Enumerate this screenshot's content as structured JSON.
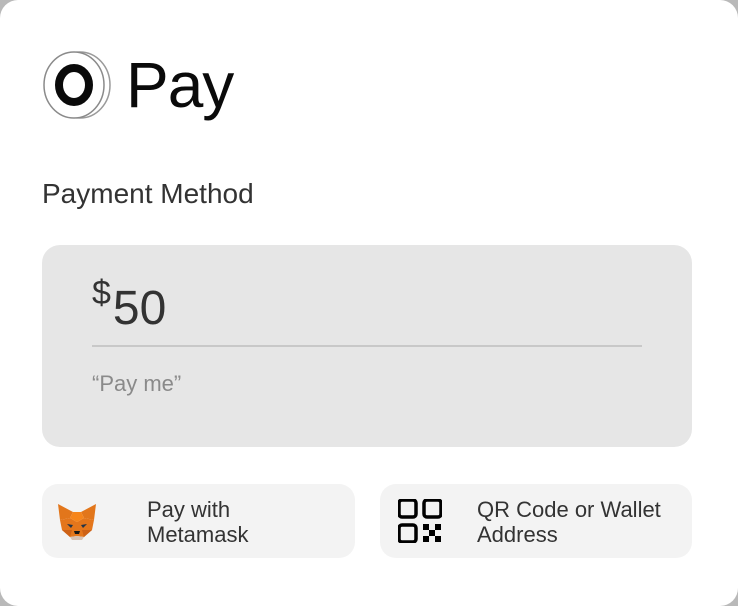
{
  "brand": {
    "name": "Pay",
    "logo_icon": "ring-logo-icon"
  },
  "payment": {
    "heading": "Payment Method",
    "currency_symbol": "$",
    "amount": "50",
    "memo": "“Pay me”"
  },
  "options": [
    {
      "label": "Pay with Metamask",
      "icon": "metamask-fox-icon"
    },
    {
      "label": "QR Code or Wallet Address",
      "icon": "qr-code-icon"
    }
  ],
  "colors": {
    "panel_bg": "#e6e6e6",
    "option_bg": "#f3f3f3",
    "text": "#333333",
    "muted": "#8a8a8a",
    "fox_orange": "#e2761b"
  }
}
